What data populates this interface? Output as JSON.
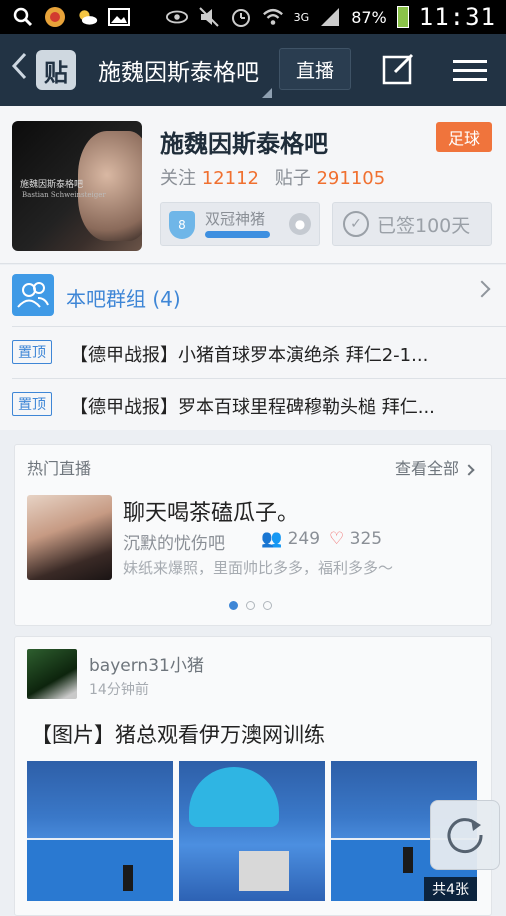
{
  "status_bar": {
    "icons": [
      "search-icon",
      "app-icon",
      "weather-icon",
      "gallery-icon",
      "eye-icon",
      "mute-icon",
      "alarm-icon",
      "wifi-icon",
      "signal-icon",
      "battery-icon"
    ],
    "network": "3G",
    "battery": "87%",
    "time": "11:31"
  },
  "app_bar": {
    "logo_text": "贴",
    "title": "施魏因斯泰格吧",
    "live_label": "直播"
  },
  "forum": {
    "name": "施魏因斯泰格吧",
    "category_tag": "足球",
    "avatar_caption": "施魏因斯泰格吧",
    "avatar_subcaption": "Bastian Schweinsteiger",
    "follow_label": "关注",
    "follow_count": "12112",
    "posts_label": "贴子",
    "posts_count": "291105",
    "level_number": "8",
    "level_title": "双冠神猪",
    "level_progress": 0.65,
    "signed_text": "已签100天"
  },
  "group": {
    "label": "本吧群组 (4)"
  },
  "pinned": [
    {
      "badge": "置顶",
      "text": "【德甲战报】小猪首球罗本演绝杀 拜仁2-1..."
    },
    {
      "badge": "置顶",
      "text": "【德甲战报】罗本百球里程碑穆勒头槌 拜仁..."
    }
  ],
  "live": {
    "header": "热门直播",
    "view_all": "查看全部",
    "title": "聊天喝茶磕瓜子。",
    "forum": "沉默的忧伤吧",
    "users": "249",
    "likes": "325",
    "desc": "妹纸来爆照，里面帅比多多，福利多多～",
    "pages": 3,
    "active_page": 0
  },
  "post": {
    "user": "bayern31小猪",
    "time": "14分钟前",
    "title": "【图片】猪总观看伊万澳网训练",
    "photo_count": "共4张"
  }
}
